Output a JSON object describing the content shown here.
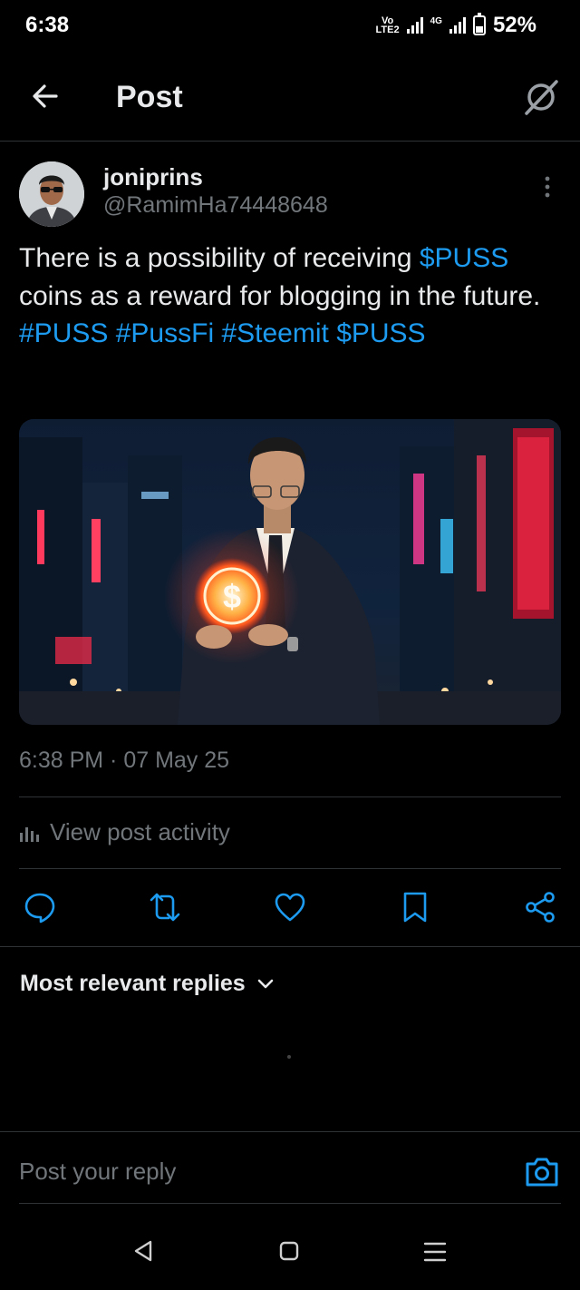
{
  "status_bar": {
    "time": "6:38",
    "carrier_badge": "Vo\nLTE2",
    "network": "4G",
    "battery_percent": "52%",
    "battery_level": 0.52
  },
  "header": {
    "title": "Post",
    "back_icon": "arrow-left-icon",
    "grok_icon": "grok-icon"
  },
  "post": {
    "author_name": "joniprins",
    "author_handle": "@RamimHa74448648",
    "text_parts": {
      "p1": "There is a possibility of receiving ",
      "p2": "$PUSS",
      "p3": " coins as a reward for blogging in the future.",
      "h1": "#PUSS",
      "h2": "#PussFi",
      "h3": "#Steemit",
      "h4": "$PUSS"
    },
    "timestamp": "6:38 PM · 07 May 25",
    "activity_label": "View post activity"
  },
  "actions": [
    "reply-icon",
    "repost-icon",
    "like-icon",
    "bookmark-icon",
    "share-icon"
  ],
  "replies": {
    "header": "Most relevant replies"
  },
  "composer": {
    "placeholder": "Post your reply"
  },
  "colors": {
    "accent": "#1d9bf0",
    "background": "#000000",
    "muted": "#71767b",
    "divider": "#2f3336"
  }
}
